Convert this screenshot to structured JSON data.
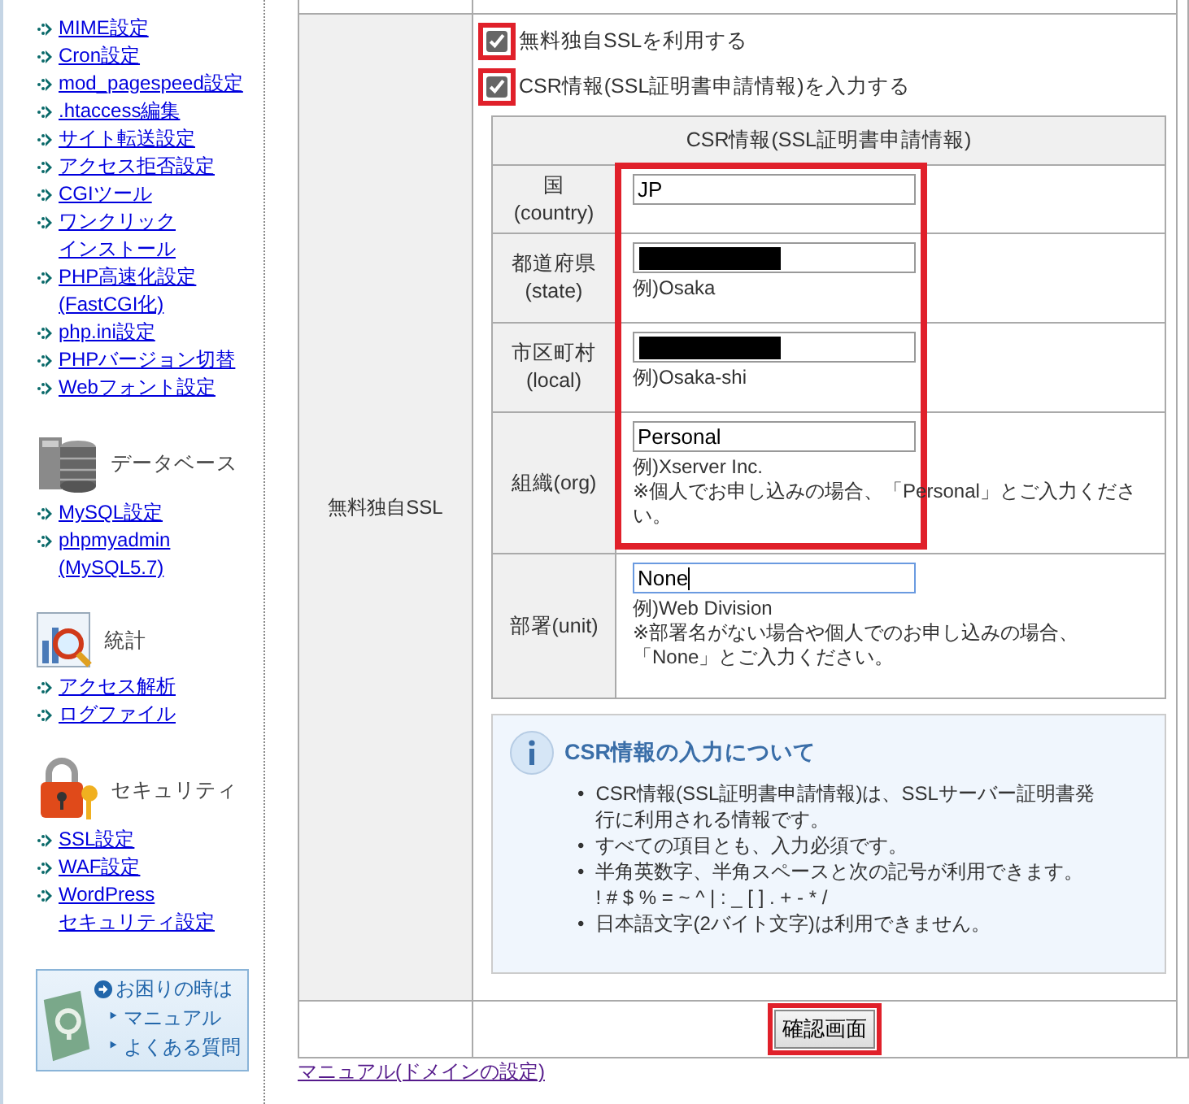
{
  "sidebar": {
    "groups": [
      {
        "kind": "links",
        "items": [
          [
            "MIME設定"
          ],
          [
            "Cron設定"
          ],
          [
            "mod_pagespeed設定"
          ],
          [
            ".htaccess編集"
          ],
          [
            "サイト転送設定"
          ],
          [
            "アクセス拒否設定"
          ],
          [
            "CGIツール"
          ],
          [
            "ワンクリック",
            "インストール"
          ],
          [
            "PHP高速化設定",
            "(FastCGI化)"
          ],
          [
            "php.ini設定"
          ],
          [
            "PHPバージョン切替"
          ],
          [
            "Webフォント設定"
          ]
        ]
      },
      {
        "kind": "database",
        "title": "データベース",
        "items": [
          [
            "MySQL設定"
          ],
          [
            "phpmyadmin",
            "(MySQL5.7)"
          ]
        ]
      },
      {
        "kind": "stats",
        "title": "統計",
        "items": [
          [
            "アクセス解析"
          ],
          [
            "ログファイル"
          ]
        ]
      },
      {
        "kind": "security",
        "title": "セキュリティ",
        "items": [
          [
            "SSL設定"
          ],
          [
            "WAF設定"
          ],
          [
            "WordPress",
            "セキュリティ設定"
          ]
        ]
      }
    ],
    "help_box": {
      "title": "お困りの時は",
      "marker": "‣",
      "links": [
        "マニュアル",
        "よくある質問"
      ]
    }
  },
  "form": {
    "row_label": "無料独自SSL",
    "options": [
      {
        "label": "無料独自SSLを利用する",
        "checked": true,
        "highlighted": true
      },
      {
        "label": "CSR情報(SSL証明書申請情報)を入力する",
        "checked": true,
        "highlighted": true
      }
    ],
    "csr_table": {
      "title": "CSR情報(SSL証明書申請情報)",
      "fields_highlighted": true,
      "rows": [
        {
          "label": [
            "国",
            "(country)"
          ],
          "value": "JP",
          "redacted": false,
          "focused": false
        },
        {
          "label": [
            "都道府県",
            "(state)"
          ],
          "redacted": true,
          "focused": false,
          "example": "例)Osaka"
        },
        {
          "label": [
            "市区町村",
            "(local)"
          ],
          "redacted": true,
          "focused": false,
          "example": "例)Osaka-shi"
        },
        {
          "label": [
            "組織(org)"
          ],
          "value": "Personal",
          "redacted": false,
          "focused": false,
          "example": "例)Xserver Inc.",
          "note": [
            "※個人でお申し込みの場合、「Personal」とご入力くださ",
            "い。"
          ]
        },
        {
          "label": [
            "部署(unit)"
          ],
          "value": "None",
          "redacted": false,
          "focused": true,
          "example": "例)Web Division",
          "note": [
            "※部署名がない場合や個人でのお申し込みの場合、",
            "「None」とご入力ください。"
          ]
        }
      ]
    },
    "info": {
      "title": "CSR情報の入力について",
      "marker": "•",
      "bullets": [
        [
          "CSR情報(SSL証明書申請情報)は、SSLサーバー証明書発",
          "行に利用される情報です。"
        ],
        [
          "すべての項目とも、入力必須です。"
        ],
        [
          "半角英数字、半角スペースと次の記号が利用できます。",
          "! # $ % = ~ ^ | : _ [ ] . + - * /"
        ],
        [
          "日本語文字(2バイト文字)は利用できません。"
        ]
      ]
    },
    "submit": {
      "label": "確認画面",
      "highlighted": true
    }
  },
  "footer_link": "マニュアル(ドメインの設定)"
}
